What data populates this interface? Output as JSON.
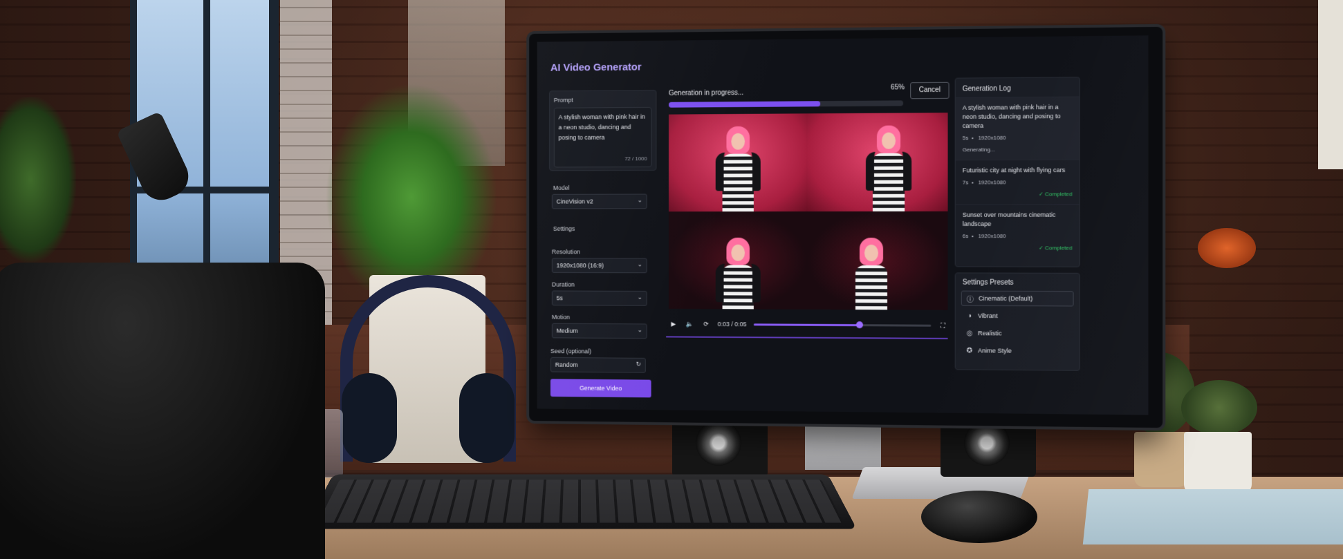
{
  "app": {
    "title": "AI Video Generator"
  },
  "prompt": {
    "label": "Prompt",
    "text": "A stylish woman with pink hair in a neon studio, dancing and posing to camera",
    "char_count": "72 / 1000"
  },
  "model": {
    "label": "Model",
    "value": "CineVision v2"
  },
  "settings": {
    "label": "Settings",
    "resolution": {
      "label": "Resolution",
      "value": "1920x1080 (16:9)"
    },
    "duration": {
      "label": "Duration",
      "value": "5s"
    },
    "motion": {
      "label": "Motion",
      "value": "Medium"
    },
    "seed": {
      "label": "Seed (optional)",
      "value": "Random"
    }
  },
  "generate_button": "Generate Video",
  "progress": {
    "label": "Generation in progress...",
    "percent_text": "65%",
    "fraction": 0.65,
    "cancel_label": "Cancel"
  },
  "player": {
    "time": "0:03 / 0:05",
    "position_fraction": 0.6,
    "icons": [
      "play-icon",
      "volume-icon",
      "loop-icon",
      "fullscreen-icon"
    ]
  },
  "log": {
    "title": "Generation Log",
    "items": [
      {
        "title": "A stylish woman with pink hair in a neon studio, dancing and posing to camera",
        "duration": "5s",
        "resolution": "1920x1080",
        "status": "Generating..."
      },
      {
        "title": "Futuristic city at night with flying cars",
        "duration": "7s",
        "resolution": "1920x1080",
        "status": "Completed"
      },
      {
        "title": "Sunset over mountains cinematic landscape",
        "duration": "6s",
        "resolution": "1920x1080",
        "status": "Completed"
      }
    ],
    "separator": "•"
  },
  "presets": {
    "title": "Settings Presets",
    "items": [
      {
        "label": "Cinematic (Default)",
        "icon": "info-icon"
      },
      {
        "label": "Vibrant",
        "icon": "palette-icon"
      },
      {
        "label": "Realistic",
        "icon": "camera-icon"
      },
      {
        "label": "Anime Style",
        "icon": "sparkle-icon"
      }
    ]
  },
  "colors": {
    "accent": "#7a4ae8",
    "title": "#b7a3ff",
    "success": "#31c766",
    "background": "#101218"
  }
}
